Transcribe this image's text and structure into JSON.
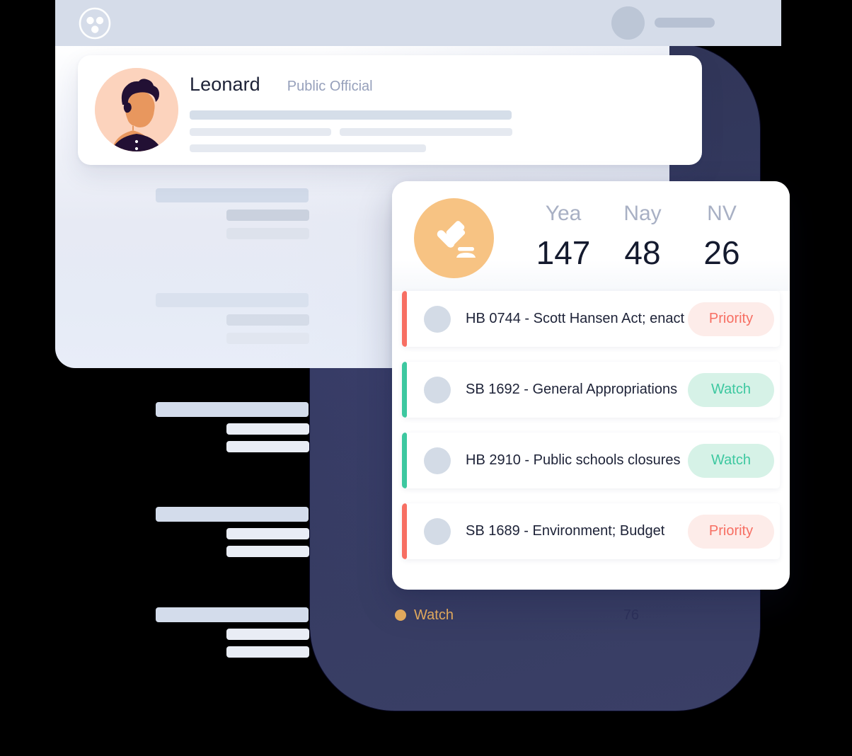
{
  "header": {
    "logo_icon": "group-circles-logo-icon",
    "user_avatar_icon": "user-avatar-placeholder-icon",
    "user_name_placeholder": ""
  },
  "profile_card": {
    "avatar_icon": "male-illustration-avatar",
    "name": "Leonard",
    "role": "Public Official"
  },
  "vote_card": {
    "gavel_icon": "gavel-icon",
    "tallies": [
      {
        "label": "Yea",
        "value": "147"
      },
      {
        "label": "Nay",
        "value": "48"
      },
      {
        "label": "NV",
        "value": "26"
      }
    ],
    "bills": [
      {
        "title": "HB 0744 - Scott Hansen Act; enact",
        "badge": "Priority",
        "status": "priority"
      },
      {
        "title": "SB 1692 - General Appropriations",
        "badge": "Watch",
        "status": "watch"
      },
      {
        "title": "HB 2910 - Public schools closures",
        "badge": "Watch",
        "status": "watch"
      },
      {
        "title": "SB 1689 - Environment; Budget",
        "badge": "Priority",
        "status": "priority"
      }
    ]
  },
  "legend": {
    "dot_icon": "watch-status-dot-icon",
    "label": "Watch",
    "count": "76"
  },
  "colors": {
    "priority": "#f76f63",
    "priority_bg": "#fdece9",
    "watch": "#3dc8a0",
    "watch_bg": "#d6f2e7",
    "gavel_circle": "#f7c383",
    "navy_backdrop": "#343a60",
    "header_bar": "#d5dce9",
    "legend_accent": "#e0a85c",
    "text_primary": "#1d2237",
    "text_muted": "#96a0bb"
  }
}
